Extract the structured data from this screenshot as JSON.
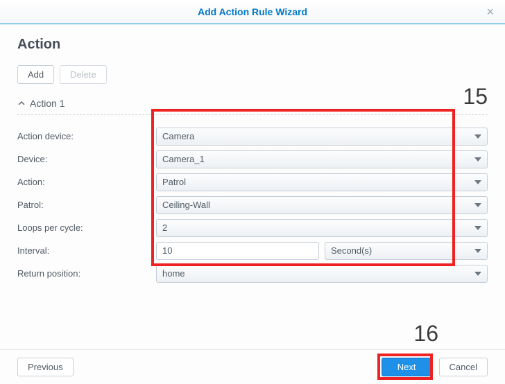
{
  "window": {
    "title": "Add Action Rule Wizard"
  },
  "section": {
    "heading": "Action"
  },
  "toolbar": {
    "add_label": "Add",
    "delete_label": "Delete"
  },
  "action_group": {
    "title": "Action 1"
  },
  "labels": {
    "action_device": "Action device:",
    "device": "Device:",
    "action": "Action:",
    "patrol": "Patrol:",
    "loops": "Loops per cycle:",
    "interval": "Interval:",
    "return_pos": "Return position:"
  },
  "values": {
    "action_device": "Camera",
    "device": "Camera_1",
    "action": "Patrol",
    "patrol": "Ceiling-Wall",
    "loops": "2",
    "interval_value": "10",
    "interval_unit": "Second(s)",
    "return_pos": "home"
  },
  "callouts": {
    "fifteen": "15",
    "sixteen": "16"
  },
  "footer": {
    "previous": "Previous",
    "next": "Next",
    "cancel": "Cancel"
  }
}
